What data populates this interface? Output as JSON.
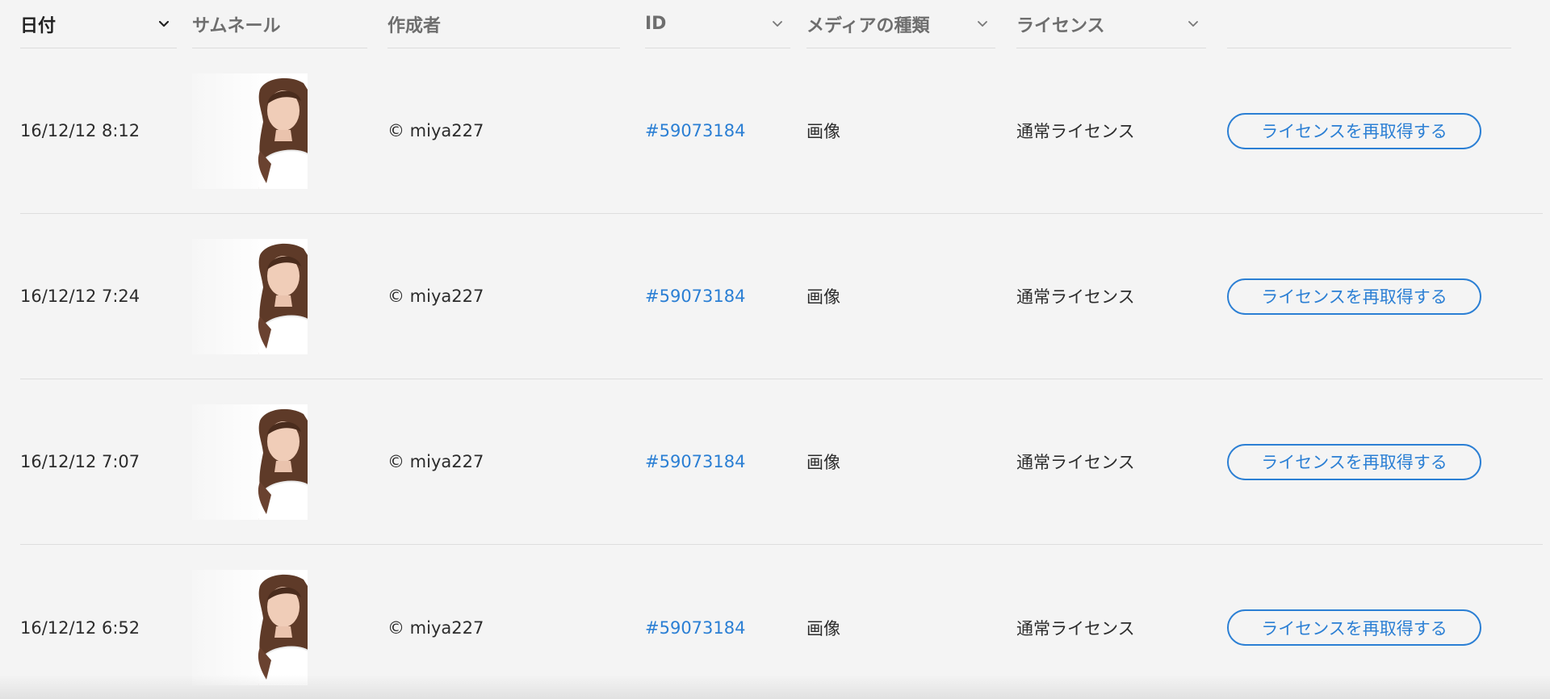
{
  "table": {
    "columns": [
      {
        "key": "date",
        "label": "日付",
        "sortable": true,
        "active": true
      },
      {
        "key": "thumbnail",
        "label": "サムネール",
        "sortable": false
      },
      {
        "key": "author",
        "label": "作成者",
        "sortable": false
      },
      {
        "key": "id",
        "label": "ID",
        "sortable": true
      },
      {
        "key": "media_type",
        "label": "メディアの種類",
        "sortable": true
      },
      {
        "key": "license",
        "label": "ライセンス",
        "sortable": true
      },
      {
        "key": "action",
        "label": "",
        "sortable": false
      }
    ],
    "rows": [
      {
        "date": "16/12/12 8:12",
        "thumbnail": "portrait-thumbnail",
        "author": "© miya227",
        "id": "#59073184",
        "media_type": "画像",
        "license": "通常ライセンス",
        "action": "ライセンスを再取得する"
      },
      {
        "date": "16/12/12 7:24",
        "thumbnail": "portrait-thumbnail",
        "author": "© miya227",
        "id": "#59073184",
        "media_type": "画像",
        "license": "通常ライセンス",
        "action": "ライセンスを再取得する"
      },
      {
        "date": "16/12/12 7:07",
        "thumbnail": "portrait-thumbnail",
        "author": "© miya227",
        "id": "#59073184",
        "media_type": "画像",
        "license": "通常ライセンス",
        "action": "ライセンスを再取得する"
      },
      {
        "date": "16/12/12 6:52",
        "thumbnail": "portrait-thumbnail",
        "author": "© miya227",
        "id": "#59073184",
        "media_type": "画像",
        "license": "通常ライセンス",
        "action": "ライセンスを再取得する"
      }
    ]
  },
  "icons": {
    "sort": "chevron-down-icon"
  },
  "colors": {
    "accent": "#2b7fd4",
    "background": "#f4f4f4",
    "text": "#2c2c2c",
    "header_text": "#6e6e6e"
  }
}
